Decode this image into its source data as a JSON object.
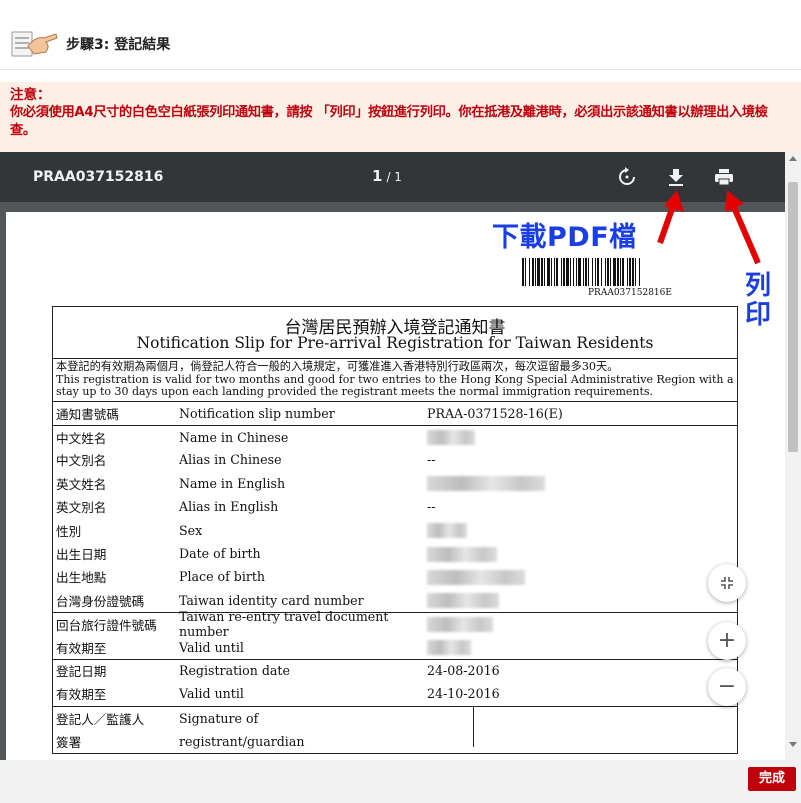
{
  "header": {
    "step_title": "步驟3: 登記結果"
  },
  "notice": {
    "title": "注意：",
    "text": "你必須使用A4尺寸的白色空白紙張列印通知書，請按 「列印」按鈕進行列印。你在抵港及離港時，必須出示該通知書以辦理出入境檢查。"
  },
  "viewer": {
    "doc_name": "PRAA037152816",
    "current_page": "1",
    "total_pages": "/ 1",
    "icons": {
      "rotate": "rotate-icon",
      "download": "download-icon",
      "print": "print-icon"
    }
  },
  "document": {
    "barcode_text": "PRAA037152816E",
    "title_zh": "台灣居民預辦入境登記通知書",
    "title_en": "Notification Slip for Pre-arrival Registration for Taiwan Residents",
    "validity_zh": "本登記的有效期為兩個月，倘登記人符合一般的入境規定，可獲准進入香港特別行政區兩次，每次逗留最多30天。",
    "validity_en": "This registration is valid for two months and good for two entries to the Hong Kong Special Administrative Region with a stay up to 30 days upon each landing provided the registrant meets the normal immigration requirements.",
    "rows": [
      {
        "zh": "通知書號碼",
        "en": "Notification slip number",
        "value": "PRAA-0371528-16(E)"
      },
      {
        "zh": "中文姓名",
        "en": "Name in Chinese",
        "value": ""
      },
      {
        "zh": "中文別名",
        "en": "Alias in Chinese",
        "value": "--"
      },
      {
        "zh": "英文姓名",
        "en": "Name in English",
        "value": ""
      },
      {
        "zh": "英文別名",
        "en": "Alias in English",
        "value": "--"
      },
      {
        "zh": "性別",
        "en": "Sex",
        "value": ""
      },
      {
        "zh": "出生日期",
        "en": "Date of birth",
        "value": ""
      },
      {
        "zh": "出生地點",
        "en": "Place of birth",
        "value": ""
      },
      {
        "zh": "台灣身份證號碼",
        "en": "Taiwan identity card number",
        "value": ""
      },
      {
        "zh": "回台旅行證件號碼",
        "en": "Taiwan re-entry travel document number",
        "value": ""
      },
      {
        "zh": "有效期至",
        "en": "Valid until",
        "value": ""
      },
      {
        "zh": "登記日期",
        "en": "Registration date",
        "value": "24-08-2016"
      },
      {
        "zh": "有效期至",
        "en": "Valid until",
        "value": "24-10-2016"
      },
      {
        "zh": "登記人／監護人",
        "en": "Signature of",
        "value": ""
      },
      {
        "zh": "簽署",
        "en": "registrant/guardian",
        "value": ""
      }
    ]
  },
  "annotations": {
    "download_label": "下載PDF檔",
    "print_label": "列印"
  },
  "zoom": {
    "fit_icon": "fit-page-icon",
    "zoom_in": "+",
    "zoom_out": "−"
  },
  "footer": {
    "finish_label": "完成"
  },
  "colors": {
    "notice_text": "#c0000b",
    "notice_bg": "#fcefe6",
    "annotation_blue": "#1a3ee6",
    "arrow_red": "#e50000",
    "finish_button": "#c0000b"
  }
}
